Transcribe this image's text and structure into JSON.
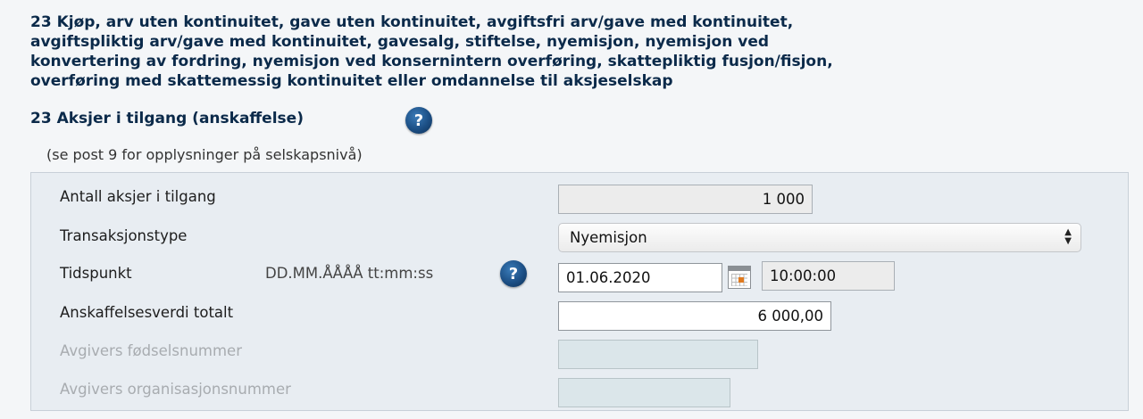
{
  "heading": {
    "lines": [
      "23 Kjøp, arv uten kontinuitet, gave uten kontinuitet, avgiftsfri arv/gave med kontinuitet,",
      "avgiftspliktig arv/gave med kontinuitet, gavesalg, stiftelse, nyemisjon, nyemisjon ved",
      "konvertering av fordring, nyemisjon ved konsernintern overføring, skattepliktig fusjon/fisjon,",
      "overføring med skattemessig kontinuitet eller omdannelse til aksjeselskap"
    ]
  },
  "section": {
    "title": "23 Aksjer i tilgang (anskaffelse)",
    "help_icon": "question-mark-icon",
    "help_glyph": "?",
    "note": "(se post 9 for opplysninger på selskapsnivå)"
  },
  "form": {
    "shares_label": "Antall aksjer i tilgang",
    "shares_value": "1 000",
    "type_label": "Transaksjonstype",
    "type_value": "Nyemisjon",
    "time_label": "Tidspunkt",
    "time_format": "DD.MM.ÅÅÅÅ tt:mm:ss",
    "date_value": "01.06.2020",
    "time_value": "10:00:00",
    "cost_label": "Anskaffelsesverdi totalt",
    "cost_value": "6 000,00",
    "ssn_label": "Avgivers fødselsnummer",
    "ssn_value": "",
    "org_label": "Avgivers organisasjonsnummer",
    "org_value": ""
  },
  "colors": {
    "heading": "#0b2a4a",
    "panel_bg": "#e8edf2",
    "help_icon": "#1c4f85",
    "calendar_accent": "#e07a1f"
  }
}
